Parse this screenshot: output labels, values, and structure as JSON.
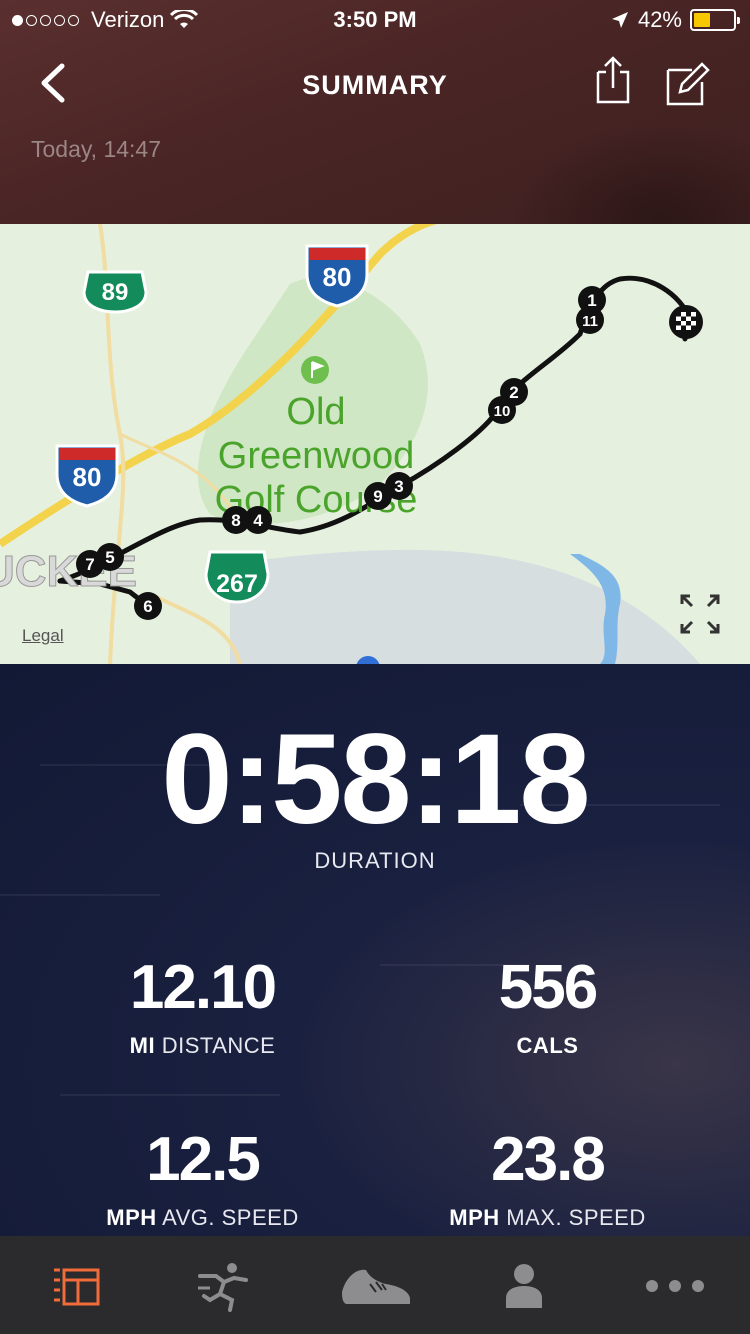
{
  "status_bar": {
    "carrier": "Verizon",
    "time": "3:50 PM",
    "battery": "42%",
    "battery_color": "#f7c800"
  },
  "nav": {
    "title": "SUMMARY",
    "back_icon": "chevron-left-icon",
    "share_icon": "share-icon",
    "edit_icon": "edit-icon"
  },
  "date": "Today, 14:47",
  "map": {
    "labels": {
      "highway_89": "89",
      "interstate_80_a": "80",
      "interstate_80_b": "80",
      "highway_267": "267",
      "golf_line1": "Old",
      "golf_line2": "Greenwood",
      "golf_line3": "Golf Course",
      "town": "UCKEE"
    },
    "split_markers": [
      "1",
      "11",
      "2",
      "10",
      "3",
      "9",
      "4",
      "8",
      "5",
      "7",
      "6"
    ],
    "legal": "Legal",
    "expand_icon": "expand-icon",
    "finish_icon": "checkered-flag-icon"
  },
  "stats": {
    "duration": {
      "value": "0:58:18",
      "label": "DURATION"
    },
    "distance": {
      "value": "12.10",
      "unit": "MI",
      "label": "DISTANCE"
    },
    "calories": {
      "value": "556",
      "label": "CALS"
    },
    "avg_speed": {
      "value": "12.5",
      "unit": "MPH",
      "label": "AVG. SPEED"
    },
    "max_speed": {
      "value": "23.8",
      "unit": "MPH",
      "label": "MAX. SPEED"
    }
  },
  "tabbar": {
    "active_color": "#f26b3a",
    "items": [
      "feed-icon",
      "activity-icon",
      "shoe-icon",
      "profile-icon",
      "more-icon"
    ]
  }
}
